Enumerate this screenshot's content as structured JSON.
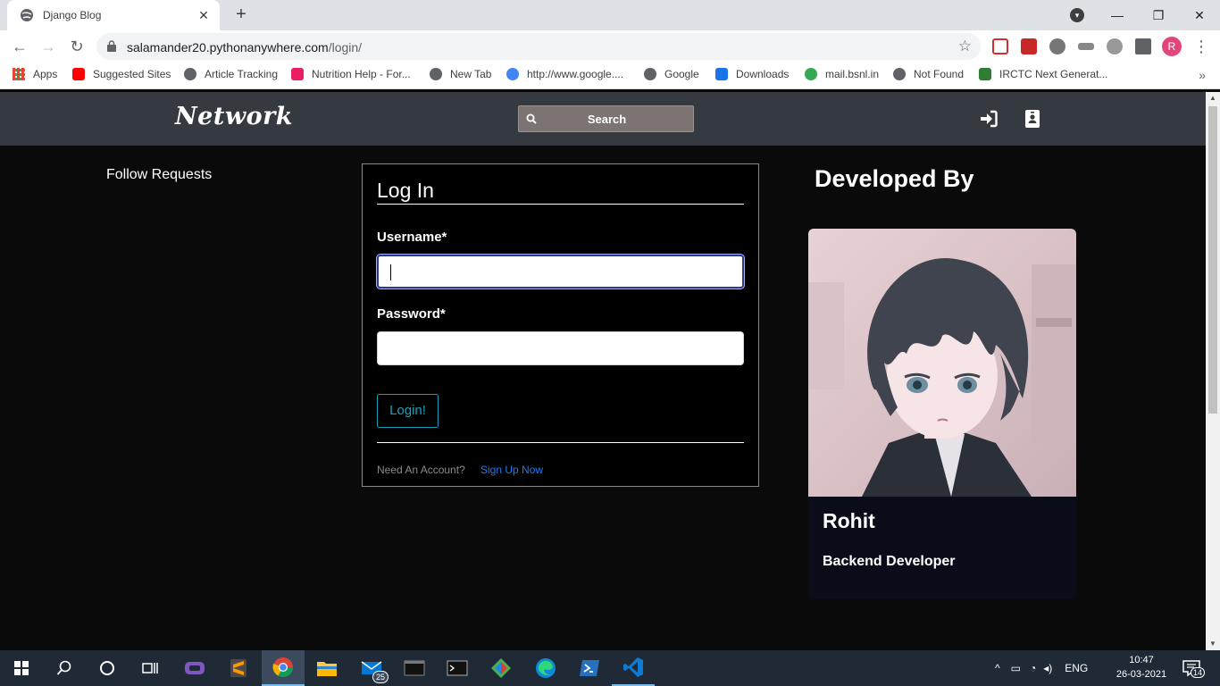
{
  "browser": {
    "tab_title": "Django Blog",
    "tab_close": "✕",
    "new_tab": "+",
    "url_host": "salamander20.pythonanywhere.com",
    "url_path": "/login/",
    "avatar_letter": "R",
    "bookmarks": [
      {
        "label": "Apps",
        "icon": "apps-grid-icon",
        "color": "#ea4335"
      },
      {
        "label": "Suggested Sites",
        "icon": "youtube-icon",
        "color": "#ff0000"
      },
      {
        "label": "Article Tracking",
        "icon": "globe-icon",
        "color": "#5f6368"
      },
      {
        "label": "Nutrition Help - For...",
        "icon": "nutrition-icon",
        "color": "#e91e63"
      },
      {
        "label": "New Tab",
        "icon": "globe-icon",
        "color": "#5f6368"
      },
      {
        "label": "http://www.google....",
        "icon": "google-icon",
        "color": "#4285f4"
      },
      {
        "label": "Google",
        "icon": "globe-icon",
        "color": "#5f6368"
      },
      {
        "label": "Downloads",
        "icon": "download-icon",
        "color": "#1a73e8"
      },
      {
        "label": "mail.bsnl.in",
        "icon": "bsnl-icon",
        "color": "#34a853"
      },
      {
        "label": "Not Found",
        "icon": "globe-icon",
        "color": "#5f6368"
      },
      {
        "label": "IRCTC Next Generat...",
        "icon": "irctc-icon",
        "color": "#2e7d32"
      }
    ]
  },
  "site": {
    "brand": "Network",
    "search_placeholder": "Search",
    "login_icon": "sign-in-icon",
    "register_icon": "id-badge-icon"
  },
  "sidebar": {
    "follow_requests": "Follow Requests"
  },
  "login": {
    "title": "Log In",
    "username_label": "Username*",
    "username_value": "",
    "password_label": "Password*",
    "password_value": "",
    "submit": "Login!",
    "need_account": "Need An Account?",
    "signup_link": "Sign Up Now"
  },
  "developer": {
    "heading": "Developed By",
    "name": "Rohit",
    "role": "Backend Developer"
  },
  "taskbar": {
    "mail_badge": "25",
    "language": "ENG",
    "time": "10:47",
    "date": "26-03-2021",
    "notification_count": "14"
  },
  "colors": {
    "navbar": "#343a40",
    "page_bg": "#0a0a0a",
    "login_button": "#17a2b8",
    "signup_link": "#1e7bf2"
  }
}
